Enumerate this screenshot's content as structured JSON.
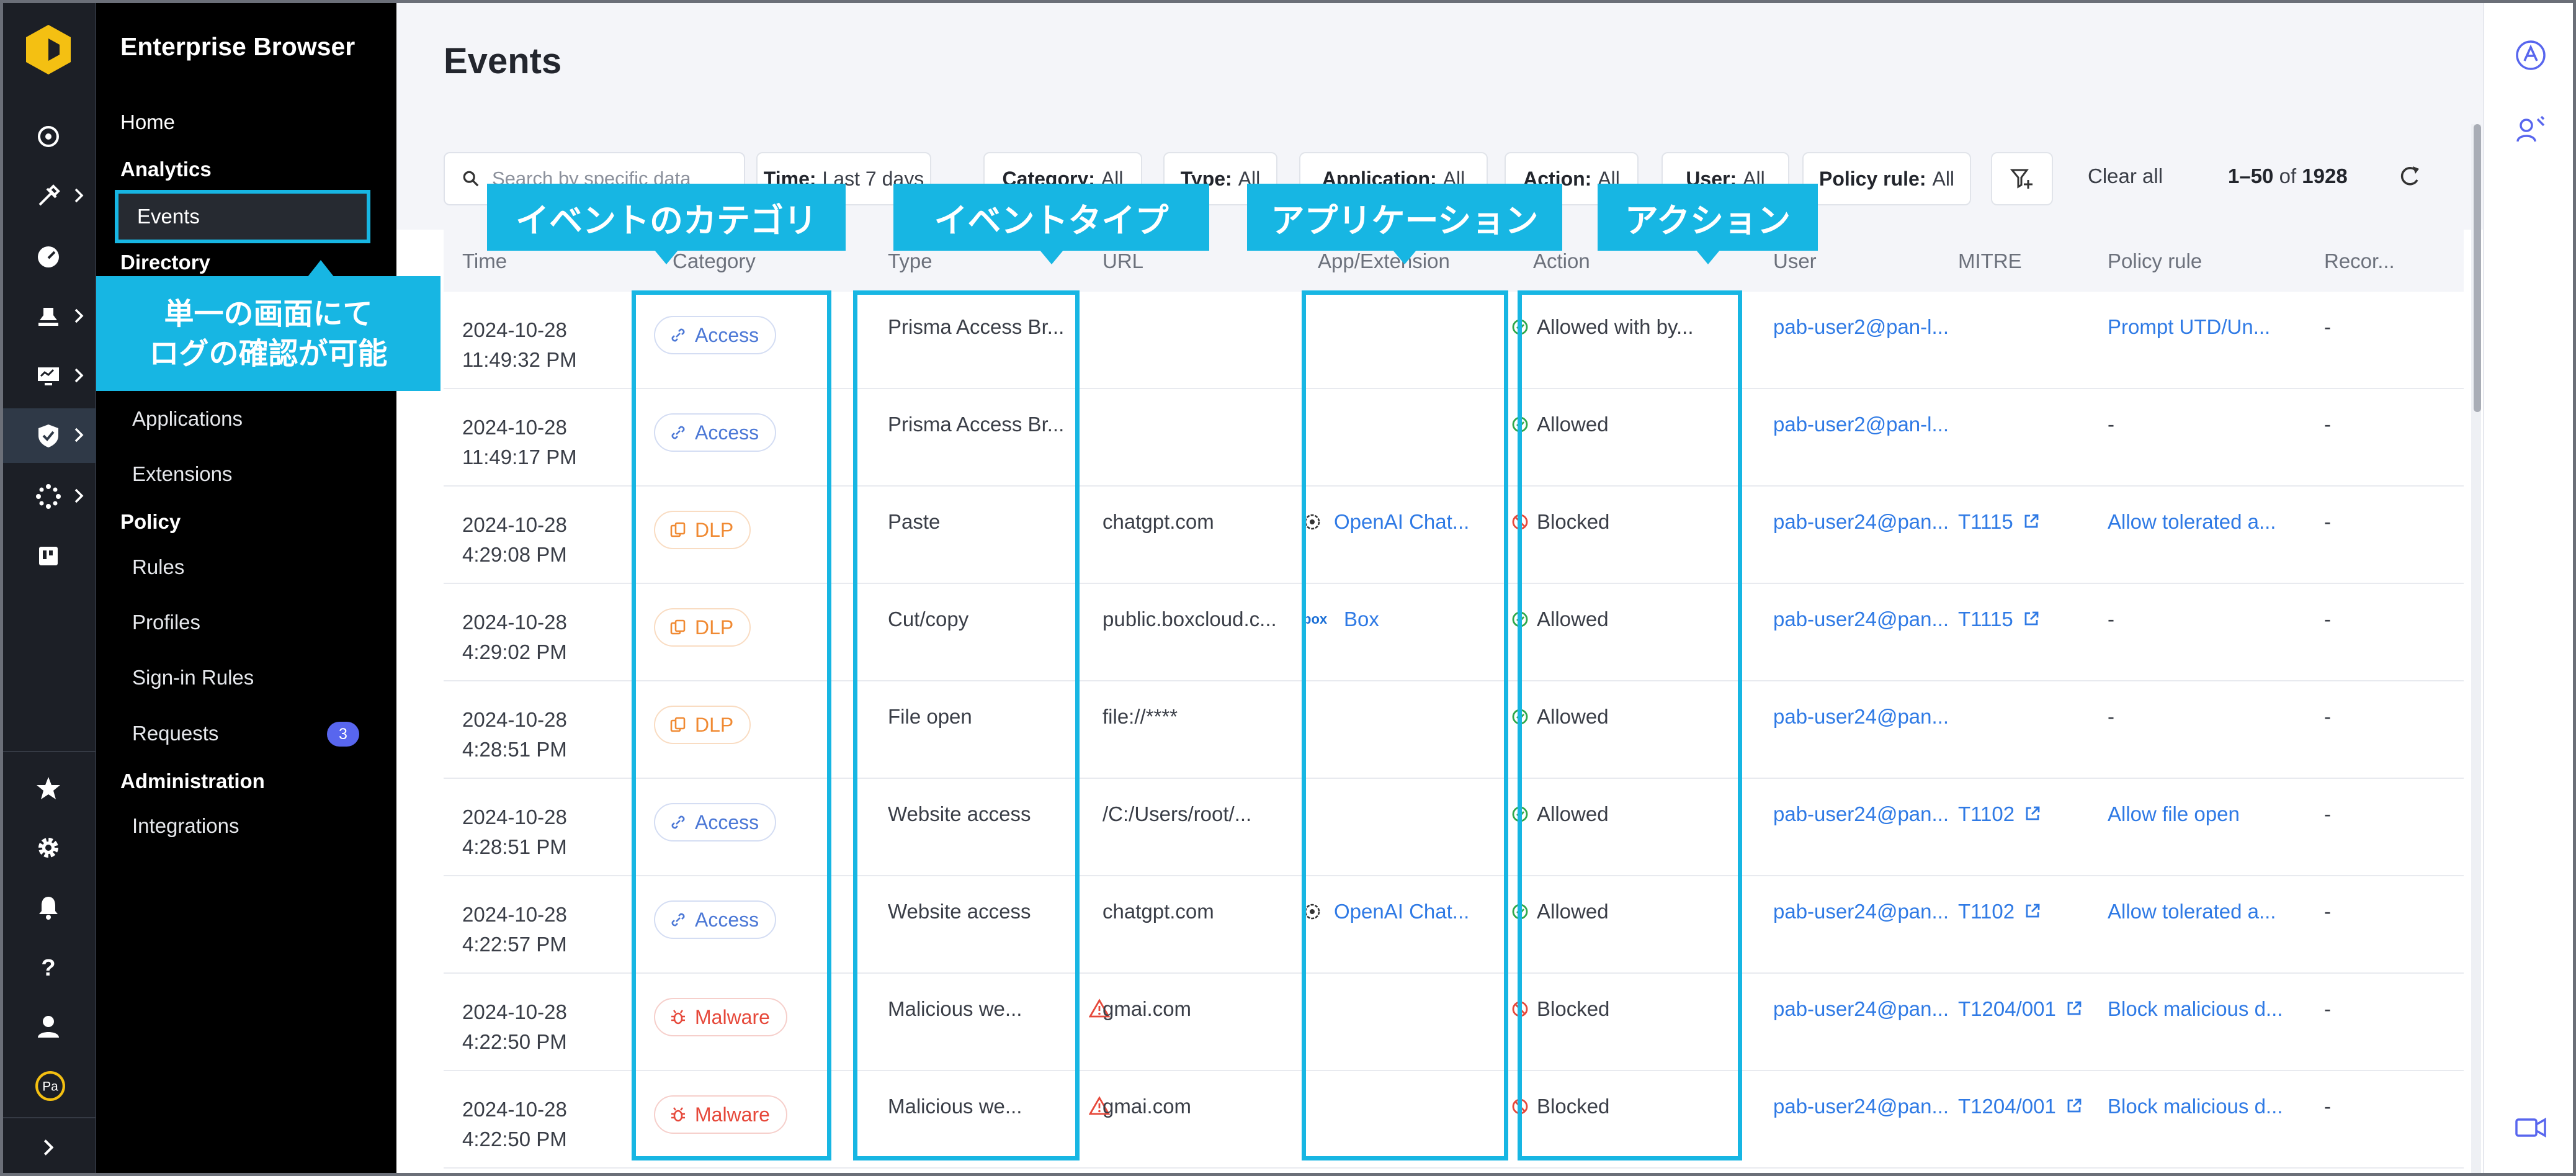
{
  "app": {
    "title": "Enterprise Browser"
  },
  "nav": {
    "home": "Home",
    "analytics": "Analytics",
    "events": "Events",
    "directory": "Directory",
    "applications": "Applications",
    "extensions": "Extensions",
    "policy": "Policy",
    "rules": "Rules",
    "profiles": "Profiles",
    "signin_rules": "Sign-in Rules",
    "requests": "Requests",
    "requests_count": "3",
    "administration": "Administration",
    "integrations": "Integrations"
  },
  "rail": {
    "avatar_initials": "Pa",
    "icons": [
      "dashboard-icon",
      "tools-icon",
      "gauge-icon",
      "stamp-icon",
      "monitor-icon",
      "shield-check-icon",
      "network-icon",
      "board-icon",
      "star-icon",
      "gear-icon",
      "bell-icon",
      "help-icon",
      "user-icon"
    ]
  },
  "page": {
    "title": "Events"
  },
  "toolbar": {
    "search_placeholder": "Search by specific data",
    "filters": [
      {
        "key": "Time:",
        "value": "Last 7 days"
      },
      {
        "key": "Category:",
        "value": "All"
      },
      {
        "key": "Type:",
        "value": "All"
      },
      {
        "key": "Application:",
        "value": "All"
      },
      {
        "key": "Action:",
        "value": "All"
      },
      {
        "key": "User:",
        "value": "All"
      },
      {
        "key": "Policy rule:",
        "value": "All"
      }
    ],
    "clear_all": "Clear all",
    "pager_range": "1–50",
    "pager_of": "of",
    "pager_total": "1928"
  },
  "table": {
    "headers": [
      "Time",
      "Category",
      "Type",
      "URL",
      "App/Extension",
      "Action",
      "User",
      "MITRE",
      "Policy rule",
      "Recor..."
    ],
    "rows": [
      {
        "date": "2024-10-28",
        "time": "11:49:32 PM",
        "category": "Access",
        "type": "Prisma Access Br...",
        "url": "",
        "app": "",
        "action": "Allowed with by...",
        "user": "pab-user2@pan-l...",
        "mitre": "",
        "policy": "Prompt UTD/Un...",
        "record": "-"
      },
      {
        "date": "2024-10-28",
        "time": "11:49:17 PM",
        "category": "Access",
        "type": "Prisma Access Br...",
        "url": "",
        "app": "",
        "action": "Allowed",
        "user": "pab-user2@pan-l...",
        "mitre": "",
        "policy": "-",
        "record": "-"
      },
      {
        "date": "2024-10-28",
        "time": "4:29:08 PM",
        "category": "DLP",
        "type": "Paste",
        "url": "chatgpt.com",
        "app": "OpenAI Chat...",
        "action": "Blocked",
        "user": "pab-user24@pan...",
        "mitre": "T1115",
        "policy": "Allow tolerated a...",
        "record": "-"
      },
      {
        "date": "2024-10-28",
        "time": "4:29:02 PM",
        "category": "DLP",
        "type": "Cut/copy",
        "url": "public.boxcloud.c...",
        "app": "Box",
        "action": "Allowed",
        "user": "pab-user24@pan...",
        "mitre": "T1115",
        "policy": "-",
        "record": "-"
      },
      {
        "date": "2024-10-28",
        "time": "4:28:51 PM",
        "category": "DLP",
        "type": "File open",
        "url": "file://****",
        "app": "",
        "action": "Allowed",
        "user": "pab-user24@pan...",
        "mitre": "",
        "policy": "-",
        "record": "-"
      },
      {
        "date": "2024-10-28",
        "time": "4:28:51 PM",
        "category": "Access",
        "type": "Website access",
        "url": "/C:/Users/root/...",
        "app": "",
        "action": "Allowed",
        "user": "pab-user24@pan...",
        "mitre": "T1102",
        "policy": "Allow file open",
        "record": "-"
      },
      {
        "date": "2024-10-28",
        "time": "4:22:57 PM",
        "category": "Access",
        "type": "Website access",
        "url": "chatgpt.com",
        "app": "OpenAI Chat...",
        "action": "Allowed",
        "user": "pab-user24@pan...",
        "mitre": "T1102",
        "policy": "Allow tolerated a...",
        "record": "-"
      },
      {
        "date": "2024-10-28",
        "time": "4:22:50 PM",
        "category": "Malware",
        "type": "Malicious we...",
        "url": "gmai.com",
        "app": "",
        "action": "Blocked",
        "user": "pab-user24@pan...",
        "mitre": "T1204/001",
        "policy": "Block malicious d...",
        "record": "-"
      },
      {
        "date": "2024-10-28",
        "time": "4:22:50 PM",
        "category": "Malware",
        "type": "Malicious we...",
        "url": "gmai.com",
        "app": "",
        "action": "Blocked",
        "user": "pab-user24@pan...",
        "mitre": "T1204/001",
        "policy": "Block malicious d...",
        "record": "-"
      }
    ]
  },
  "annotations": {
    "category": "イベントのカテゴリ",
    "type": "イベントタイプ",
    "app": "アプリケーション",
    "action": "アクション",
    "note_line1": "単一の画面にて",
    "note_line2": "ログの確認が可能"
  },
  "colors": {
    "highlight": "#17b6e3",
    "link": "#2f7ae5",
    "allowed": "#2ea84a",
    "blocked": "#e6483a",
    "dlp": "#f08a33",
    "access": "#4c78d6"
  }
}
